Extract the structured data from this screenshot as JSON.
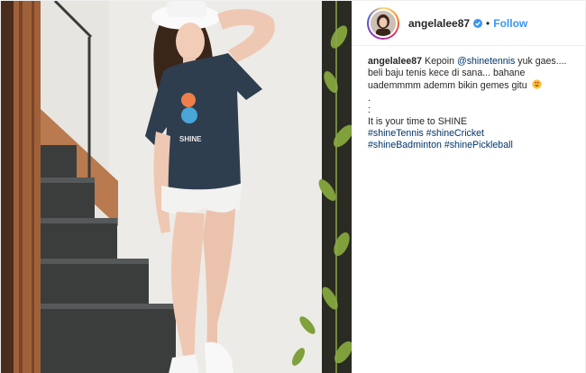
{
  "post": {
    "author": "angelalee87",
    "follow_label": "Follow",
    "separator": "•"
  },
  "caption": {
    "author": "angelalee87",
    "line1_text": "Kepoin",
    "mention": "@shinetennis",
    "line1_tail": "yuk gaes....",
    "line2": "beli baju tenis kece di sana... bahane",
    "line3": "uademmmm ademm bikin gemes gitu",
    "dot1": ".",
    "dot2": ":",
    "line_shine": "It is your time to SHINE",
    "hashtags_row1": [
      "#shineTennis",
      "#shineCricket"
    ],
    "hashtags_row2": [
      "#shineBadminton",
      "#shinePickleball"
    ]
  },
  "photo": {
    "shirt_brand": "SHINE"
  },
  "colors": {
    "link": "#003569",
    "follow": "#3897f0",
    "verified": "#3897f0",
    "shirt": "#2f3e4e"
  },
  "icons": [
    "verified-badge-icon",
    "heart-eyes-emoji-icon"
  ]
}
